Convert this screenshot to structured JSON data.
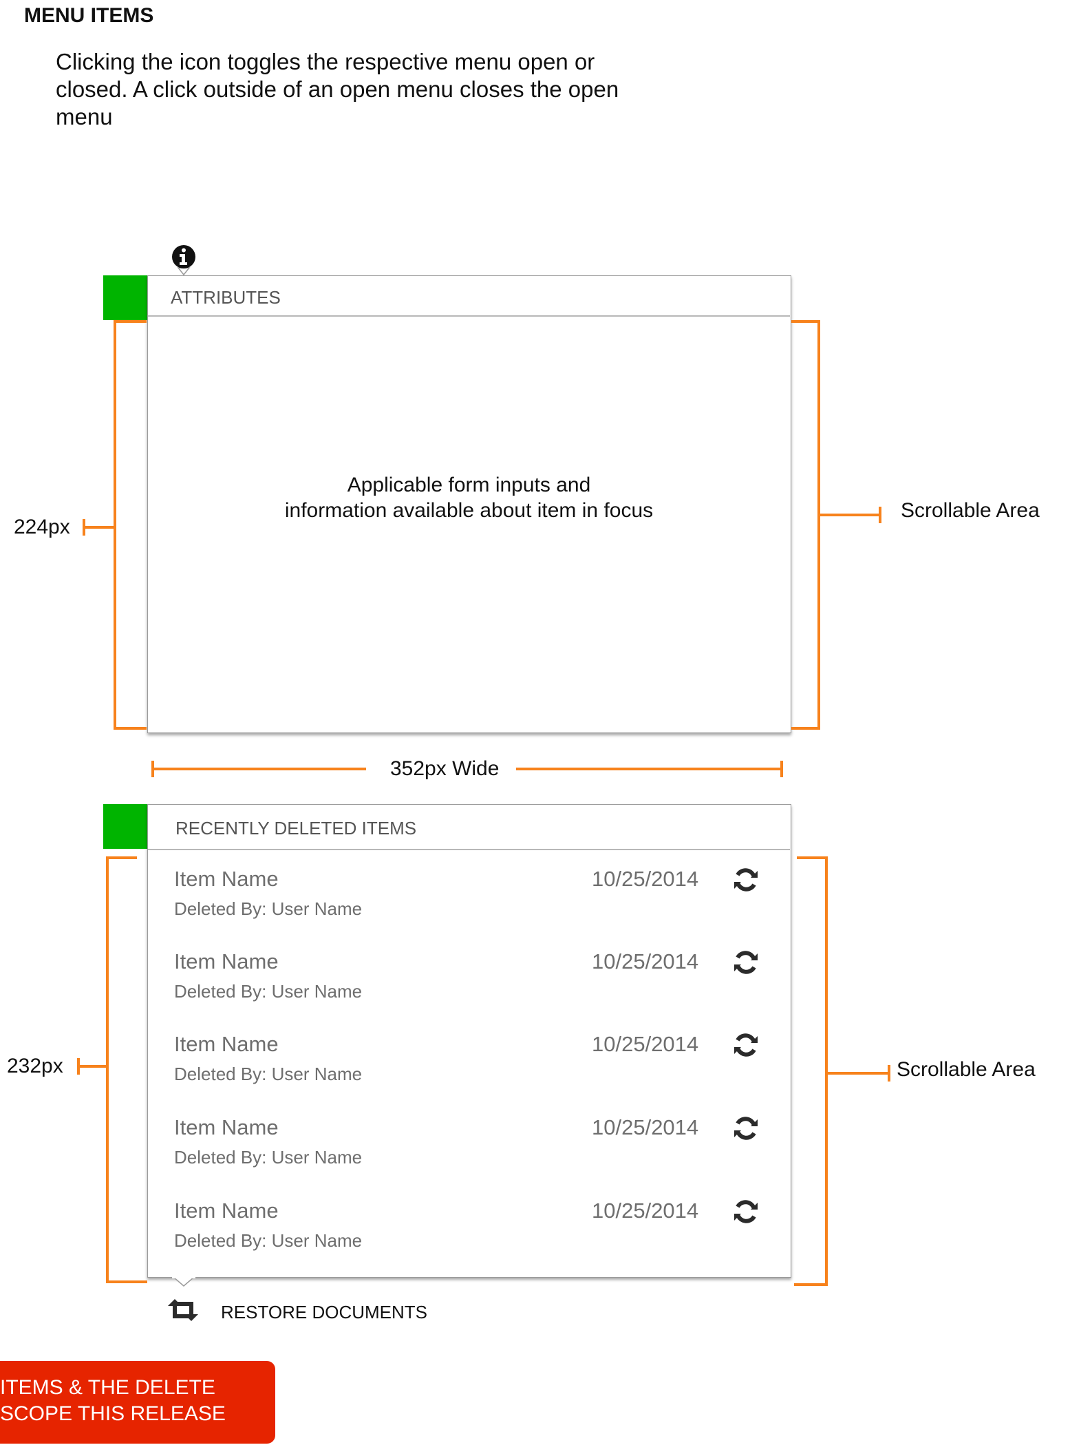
{
  "heading": "MENU ITEMS",
  "description": "Clicking the icon toggles the respective menu open or closed. A click outside of an open menu closes the open menu",
  "attributes_panel": {
    "title": "ATTRIBUTES",
    "body_line1": "Applicable form inputs and",
    "body_line2": "information available about item in focus",
    "height_note": "224px",
    "scroll_note": "Scrollable Area",
    "width_note": "352px Wide",
    "icon": "info-icon"
  },
  "deleted_panel": {
    "title": "RECENTLY DELETED ITEMS",
    "height_note": "232px",
    "scroll_note": "Scrollable Area",
    "items": [
      {
        "name": "Item Name",
        "deleted_by": "Deleted By: User Name",
        "date": "10/25/2014"
      },
      {
        "name": "Item Name",
        "deleted_by": "Deleted By: User Name",
        "date": "10/25/2014"
      },
      {
        "name": "Item Name",
        "deleted_by": "Deleted By: User Name",
        "date": "10/25/2014"
      },
      {
        "name": "Item Name",
        "deleted_by": "Deleted By: User Name",
        "date": "10/25/2014"
      },
      {
        "name": "Item Name",
        "deleted_by": "Deleted By: User Name",
        "date": "10/25/2014"
      }
    ],
    "restore_label": "RESTORE DOCUMENTS",
    "restore_icon": "retweet-icon",
    "item_icon": "refresh-icon"
  },
  "warning": {
    "line1": "ITEMS & THE DELETE",
    "line2": "SCOPE THIS RELEASE"
  },
  "colors": {
    "annotation": "#f7821c",
    "marker": "#00b400",
    "warning": "#e62400"
  }
}
